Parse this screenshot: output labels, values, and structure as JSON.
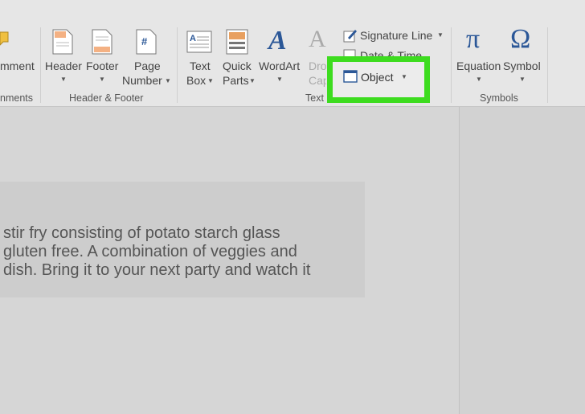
{
  "ribbon": {
    "comment_partial": "mment",
    "comments_group_partial": "nments",
    "header_label": "Header",
    "footer_label": "Footer",
    "page_number_line1": "Page",
    "page_number_line2": "Number",
    "header_footer_group": "Header & Footer",
    "textbox_line1": "Text",
    "textbox_line2": "Box",
    "quickparts_line1": "Quick",
    "quickparts_line2": "Parts",
    "wordart_label": "WordArt",
    "dropcap_line1": "Dro",
    "dropcap_line2": "Cap",
    "signature_line": "Signature Line",
    "date_time": "Date & Time",
    "object_label": "Object",
    "text_group": "Text",
    "equation_label": "Equation",
    "symbol_label": "Symbol",
    "symbols_group": "Symbols",
    "pi_glyph": "π",
    "omega_glyph": "Ω",
    "wordart_glyph": "A",
    "dropcap_glyph": "A",
    "pagenum_glyph": "#"
  },
  "document": {
    "line1": "stir fry consisting of potato starch glass",
    "line2": "gluten free. A combination of veggies and",
    "line3": "dish. Bring it to your next party and watch it"
  },
  "colors": {
    "highlight": "#3ddc1f",
    "accent_blue": "#2b5797"
  }
}
